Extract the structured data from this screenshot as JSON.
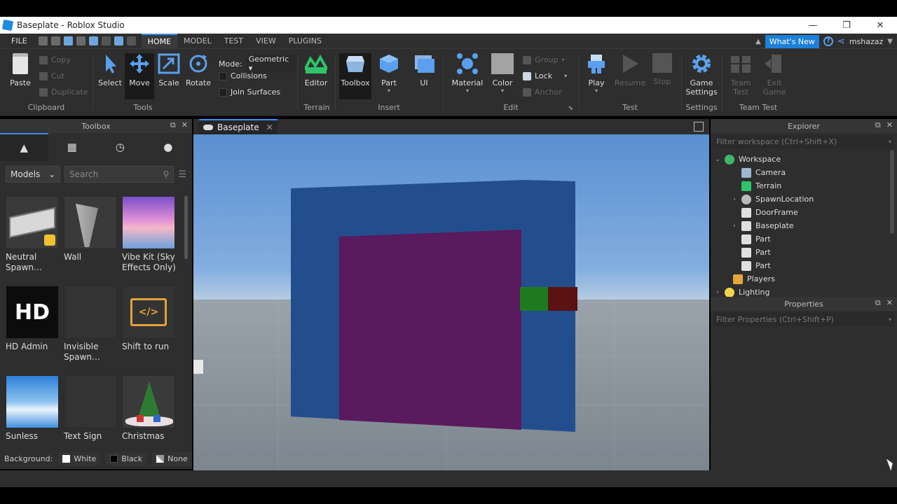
{
  "window": {
    "title": "Baseplate - Roblox Studio",
    "controls": [
      "—",
      "❐",
      "✕"
    ]
  },
  "menu": {
    "file": "FILE",
    "tabs": [
      "HOME",
      "MODEL",
      "TEST",
      "VIEW",
      "PLUGINS"
    ],
    "active_tab": "HOME",
    "whats_new": "What's New",
    "help": "?",
    "username": "mshazaz"
  },
  "ribbon": {
    "clipboard": {
      "paste": "Paste",
      "copy": "Copy",
      "cut": "Cut",
      "duplicate": "Duplicate",
      "label": "Clipboard"
    },
    "tools": {
      "select": "Select",
      "move": "Move",
      "scale": "Scale",
      "rotate": "Rotate",
      "label": "Tools",
      "mode_label": "Mode:",
      "mode_value": "Geometric",
      "collisions": "Collisions",
      "join_surfaces": "Join Surfaces"
    },
    "terrain": {
      "editor": "Editor",
      "label": "Terrain"
    },
    "insert": {
      "toolbox": "Toolbox",
      "part": "Part",
      "ui": "UI",
      "label": "Insert"
    },
    "edit": {
      "material": "Material",
      "color": "Color",
      "group": "Group",
      "lock": "Lock",
      "anchor": "Anchor",
      "label": "Edit"
    },
    "test": {
      "play": "Play",
      "resume": "Resume",
      "stop": "Stop",
      "label": "Test"
    },
    "settings": {
      "game_settings_1": "Game",
      "game_settings_2": "Settings",
      "label": "Settings"
    },
    "team_test": {
      "team_test_1": "Team",
      "team_test_2": "Test",
      "exit_game_1": "Exit",
      "exit_game_2": "Game",
      "label": "Team Test"
    }
  },
  "toolbox": {
    "title": "Toolbox",
    "category": "Models",
    "search_placeholder": "Search",
    "items": [
      {
        "name": "Neutral Spawn…"
      },
      {
        "name": "Wall"
      },
      {
        "name": "Vibe Kit (Sky Effects Only)"
      },
      {
        "name": "HD Admin"
      },
      {
        "name": "Invisible Spawn…"
      },
      {
        "name": "Shift to run"
      },
      {
        "name": "Sunless"
      },
      {
        "name": "Text Sign"
      },
      {
        "name": "Christmas"
      }
    ],
    "hd_logo": "HD",
    "background_label": "Background:",
    "bg_white": "White",
    "bg_black": "Black",
    "bg_none": "None"
  },
  "viewport": {
    "tab": "Baseplate",
    "colors": {
      "frame": "#234e8e",
      "door": "#5a1a5e",
      "green": "#1f7a1f",
      "maroon": "#5a1212"
    }
  },
  "explorer": {
    "title": "Explorer",
    "filter_placeholder": "Filter workspace (Ctrl+Shift+X)",
    "nodes": [
      {
        "label": "Workspace",
        "icon": "globe-icon"
      },
      {
        "label": "Camera",
        "icon": "camera-icon"
      },
      {
        "label": "Terrain",
        "icon": "terrain-icon"
      },
      {
        "label": "SpawnLocation",
        "icon": "spawn-icon"
      },
      {
        "label": "DoorFrame",
        "icon": "model-icon"
      },
      {
        "label": "Baseplate",
        "icon": "part-icon"
      },
      {
        "label": "Part",
        "icon": "part-icon"
      },
      {
        "label": "Part",
        "icon": "part-icon"
      },
      {
        "label": "Part",
        "icon": "part-icon"
      },
      {
        "label": "Players",
        "icon": "players-icon"
      },
      {
        "label": "Lighting",
        "icon": "lighting-icon"
      }
    ]
  },
  "properties": {
    "title": "Properties",
    "filter_placeholder": "Filter Properties (Ctrl+Shift+P)"
  }
}
